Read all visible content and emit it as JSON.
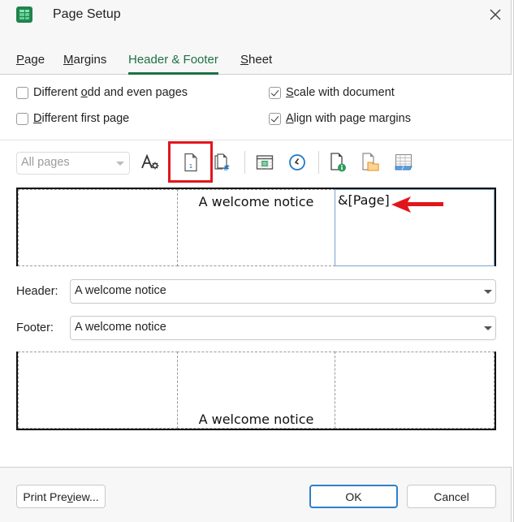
{
  "window": {
    "title": "Page Setup",
    "app_icon": "spreadsheet-grid-icon",
    "close_icon": "close-icon"
  },
  "tabs": [
    {
      "label": "Page",
      "mnemonic": "P",
      "active": false
    },
    {
      "label": "Margins",
      "mnemonic": "M",
      "active": false
    },
    {
      "label": "Header & Footer",
      "active": true
    },
    {
      "label": "Sheet",
      "mnemonic": "S",
      "active": false
    }
  ],
  "options": {
    "different_odd_even": {
      "label_pre": "Different ",
      "mnemonic": "o",
      "label_post": "dd and even pages",
      "checked": false
    },
    "different_first": {
      "label_pre": "",
      "mnemonic": "D",
      "label_post": "ifferent first page",
      "checked": false
    },
    "scale_with_document": {
      "label_pre": "",
      "mnemonic": "S",
      "label_post": "cale with document",
      "checked": true
    },
    "align_with_margins": {
      "label_pre": "",
      "mnemonic": "A",
      "label_post": "lign with page margins",
      "checked": true
    }
  },
  "toolbar": {
    "page_scope": {
      "value": "All pages",
      "disabled": true
    },
    "buttons": [
      {
        "name": "format-text",
        "icon": "font-settings-icon"
      },
      {
        "name": "insert-page-number",
        "icon": "page-number-icon",
        "highlighted": true
      },
      {
        "name": "insert-number-of-pages",
        "icon": "page-count-icon"
      },
      {
        "name": "insert-date",
        "icon": "calendar-icon"
      },
      {
        "name": "insert-time",
        "icon": "clock-icon"
      },
      {
        "name": "insert-file-path",
        "icon": "file-info-icon"
      },
      {
        "name": "insert-file-name",
        "icon": "file-folder-icon"
      },
      {
        "name": "insert-sheet-name",
        "icon": "sheet-tab-icon"
      }
    ]
  },
  "header_preview": {
    "left": "",
    "center": "A welcome notice",
    "right": "&[Page]"
  },
  "header": {
    "label": "Header:",
    "value": "A welcome notice"
  },
  "footer": {
    "label": "Footer:",
    "value": "A welcome notice"
  },
  "footer_preview": {
    "left": "",
    "center": "A welcome notice",
    "right": ""
  },
  "annotation": {
    "arrow_color": "#e1161c",
    "highlight_color": "#e1161c"
  },
  "buttons": {
    "print_preview": {
      "pre": "Print Pre",
      "mnemonic": "v",
      "post": "iew..."
    },
    "ok": "OK",
    "cancel": "Cancel"
  },
  "colors": {
    "accent": "#1e7145",
    "primary_button_border": "#2f80c8"
  }
}
